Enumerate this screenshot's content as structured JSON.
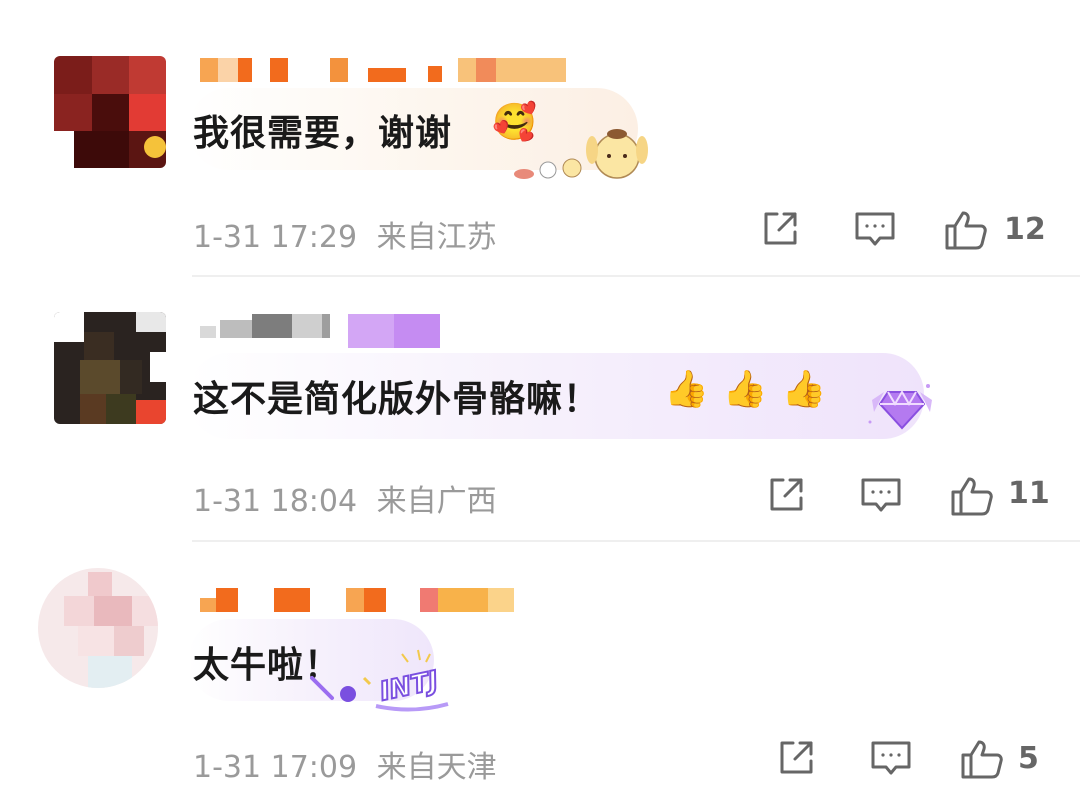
{
  "comments": [
    {
      "text": "我很需要，谢谢",
      "emoji": "🥰",
      "time": "1-31 17:29",
      "location": "来自江苏",
      "likes": "12",
      "bubble_theme": "pompompurin-sticker"
    },
    {
      "text": "这不是简化版外骨骼嘛！",
      "emoji": "👍👍👍",
      "time": "1-31 18:04",
      "location": "来自广西",
      "likes": "11",
      "bubble_theme": "purple-gem-badge"
    },
    {
      "text": "太牛啦！",
      "emoji": "",
      "time": "1-31 17:09",
      "location": "来自天津",
      "likes": "5",
      "bubble_theme": "intj-badge",
      "badge_text": "INTJ"
    }
  ],
  "icons": {
    "share": "share-icon",
    "comment": "comment-icon",
    "like": "thumbs-up-icon"
  },
  "colors": {
    "text": "#1a1a1a",
    "meta": "#9a9a9a",
    "icon": "#666666",
    "name_orange": "#f26b1d",
    "name_purple": "#c58cf2"
  }
}
